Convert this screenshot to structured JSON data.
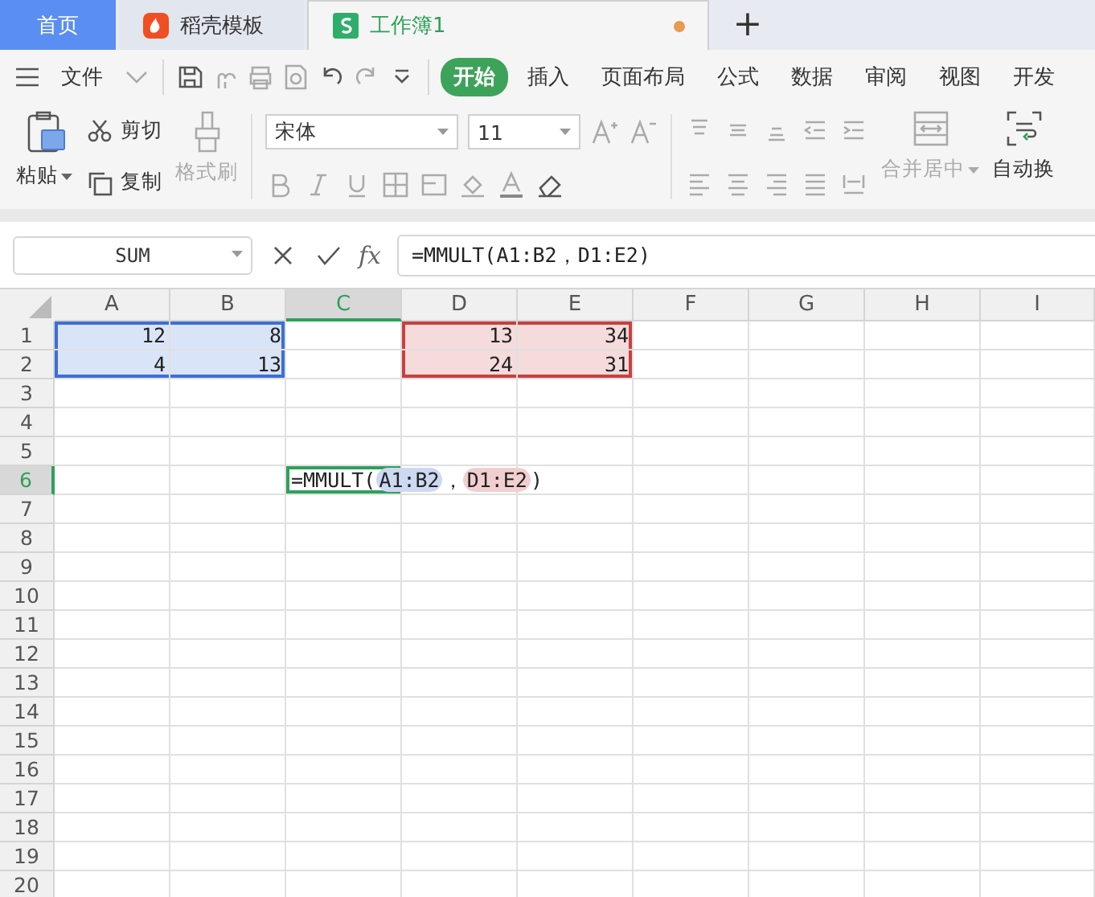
{
  "tabs": [
    {
      "label": "首页",
      "kind": "home",
      "selected": false,
      "modified": false
    },
    {
      "label": "稻壳模板",
      "kind": "docer",
      "selected": false,
      "modified": false
    },
    {
      "label": "工作簿1",
      "kind": "sheet",
      "selected": true,
      "modified": true
    }
  ],
  "new_tab": "+",
  "menu": {
    "file": "文件",
    "tabs": [
      {
        "label": "开始",
        "selected": true
      },
      {
        "label": "插入",
        "selected": false
      },
      {
        "label": "页面布局",
        "selected": false
      },
      {
        "label": "公式",
        "selected": false
      },
      {
        "label": "数据",
        "selected": false
      },
      {
        "label": "审阅",
        "selected": false
      },
      {
        "label": "视图",
        "selected": false
      },
      {
        "label": "开发",
        "selected": false
      }
    ]
  },
  "ribbon": {
    "paste": "粘贴",
    "cut": "剪切",
    "copy": "复制",
    "format_painter": {
      "label": "格式刷",
      "disabled": true
    },
    "font": "宋体",
    "size": "11",
    "merge": {
      "label": "合并居中",
      "disabled": true
    },
    "wrap": {
      "label": "自动换",
      "disabled": false
    }
  },
  "formula_bar": {
    "name_box": "SUM",
    "fx": "fx",
    "formula": "=MMULT(A1:B2，D1:E2)"
  },
  "sheet": {
    "columns": [
      {
        "label": "A",
        "selected": false
      },
      {
        "label": "B",
        "selected": false
      },
      {
        "label": "C",
        "selected": true
      },
      {
        "label": "D",
        "selected": false
      },
      {
        "label": "E",
        "selected": false
      },
      {
        "label": "F",
        "selected": false
      },
      {
        "label": "G",
        "selected": false
      },
      {
        "label": "H",
        "selected": false
      },
      {
        "label": "I",
        "selected": false
      }
    ],
    "rows": [
      {
        "label": "1",
        "selected": false,
        "cells": [
          {
            "value": "12",
            "color": "#3c6fd8"
          },
          {
            "value": "8",
            "color": "#3c6fd8"
          },
          null,
          {
            "value": "13",
            "color": "#c9403f"
          },
          {
            "value": "34",
            "color": "#c9403f"
          }
        ]
      },
      {
        "label": "2",
        "selected": false,
        "cells": [
          {
            "value": "4",
            "color": "#3c6fd8"
          },
          {
            "value": "13",
            "color": "#3c6fd8"
          },
          null,
          {
            "value": "24",
            "color": "#c9403f"
          },
          {
            "value": "31",
            "color": "#c9403f"
          }
        ]
      },
      {
        "label": "3",
        "selected": false
      },
      {
        "label": "4",
        "selected": false
      },
      {
        "label": "5",
        "selected": false
      },
      {
        "label": "6",
        "selected": true
      },
      {
        "label": "7",
        "selected": false
      },
      {
        "label": "8",
        "selected": false
      },
      {
        "label": "9",
        "selected": false
      },
      {
        "label": "10",
        "selected": false
      },
      {
        "label": "11",
        "selected": false
      },
      {
        "label": "12",
        "selected": false
      },
      {
        "label": "13",
        "selected": false
      },
      {
        "label": "14",
        "selected": false
      },
      {
        "label": "15",
        "selected": false
      },
      {
        "label": "16",
        "selected": false
      },
      {
        "label": "17",
        "selected": false
      },
      {
        "label": "18",
        "selected": false
      },
      {
        "label": "19",
        "selected": false
      },
      {
        "label": "20",
        "selected": false
      }
    ],
    "editor": [
      {
        "kind": "text",
        "text": "=MMULT("
      },
      {
        "kind": "ref",
        "text": "A1:B2",
        "color": "#cdd8f2"
      },
      {
        "kind": "text",
        "text": "，"
      },
      {
        "kind": "ref",
        "text": "D1:E2",
        "color": "#f2cfcf"
      },
      {
        "kind": "text",
        "text": ")"
      }
    ]
  }
}
